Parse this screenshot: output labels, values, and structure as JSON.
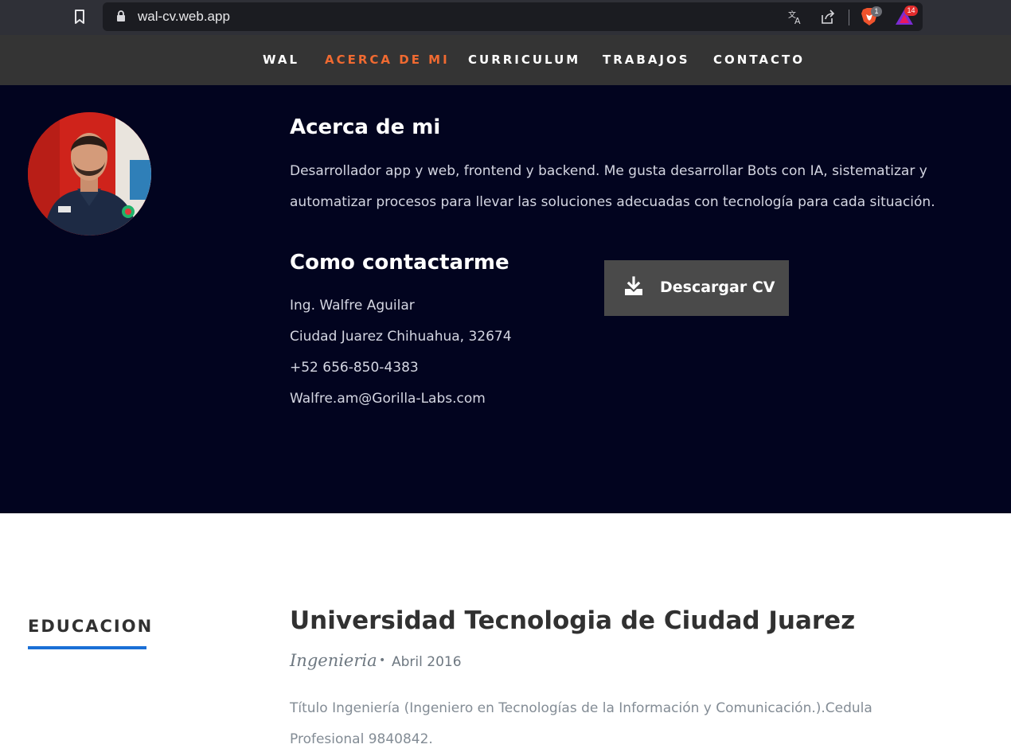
{
  "browser": {
    "url": "wal-cv.web.app",
    "shields_badge": "1",
    "rewards_badge": "14"
  },
  "nav": {
    "items": [
      {
        "label": "WAL",
        "active": false
      },
      {
        "label": "ACERCA DE MI",
        "active": true
      },
      {
        "label": "CURRICULUM",
        "active": false
      },
      {
        "label": "TRABAJOS",
        "active": false
      },
      {
        "label": "CONTACTO",
        "active": false
      }
    ]
  },
  "about": {
    "title": "Acerca de mi",
    "text": "Desarrollador app y web, frontend y backend. Me gusta desarrollar Bots con IA, sistematizar y automatizar procesos para llevar las soluciones adecuadas con tecnología para cada situación.",
    "contact_title": "Como contactarme",
    "contact_lines": [
      "Ing. Walfre Aguilar",
      "Ciudad Juarez Chihuahua, 32674",
      "+52 656-850-4383",
      "Walfre.am@Gorilla-Labs.com"
    ],
    "download_label": "Descargar CV"
  },
  "education": {
    "heading": "EDUCACION",
    "school": "Universidad Tecnologia de Ciudad Juarez",
    "degree": "Ingenieria",
    "bullet": "•",
    "date": "Abril 2016",
    "description": "Título Ingeniería (Ingeniero en Tecnologías de la Información y Comunicación.).Cedula Profesional 9840842."
  },
  "colors": {
    "nav_bg": "#343434",
    "nav_active": "#f06a31",
    "about_bg": "#02041f",
    "button_bg": "#4a4a4a",
    "edu_underline": "#1a6fd6"
  }
}
